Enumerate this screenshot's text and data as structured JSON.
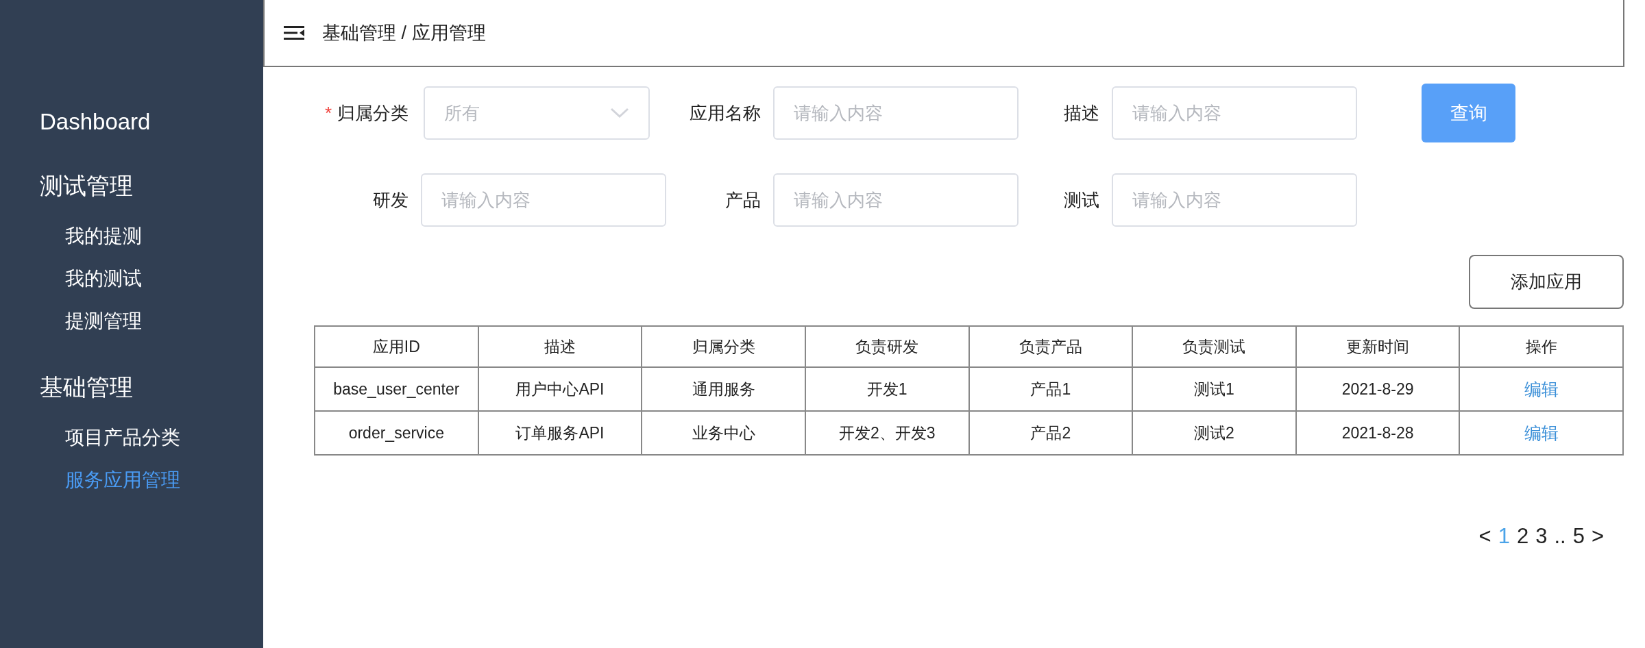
{
  "sidebar": {
    "items": [
      {
        "label": "Dashboard",
        "selected": false
      },
      {
        "label": "测试管理",
        "selected": false,
        "children": [
          {
            "label": "我的提测",
            "selected": false
          },
          {
            "label": "我的测试",
            "selected": false
          },
          {
            "label": "提测管理",
            "selected": false
          }
        ]
      },
      {
        "label": "基础管理",
        "selected": false,
        "children": [
          {
            "label": "项目产品分类",
            "selected": false
          },
          {
            "label": "服务应用管理",
            "selected": true
          }
        ]
      }
    ]
  },
  "header": {
    "breadcrumb": "基础管理 / 应用管理"
  },
  "filters": [
    {
      "label": "归属分类",
      "kind": "select",
      "required_mark": "*",
      "placeholder": "所有"
    },
    {
      "label": "应用名称",
      "kind": "input",
      "placeholder": "请输入内容"
    },
    {
      "label": "描述",
      "kind": "input",
      "placeholder": "请输入内容"
    },
    {
      "label": "研发",
      "kind": "input",
      "placeholder": "请输入内容"
    },
    {
      "label": "产品",
      "kind": "input",
      "placeholder": "请输入内容"
    },
    {
      "label": "测试",
      "kind": "input",
      "placeholder": "请输入内容"
    }
  ],
  "query_button": "查询",
  "add_button": "添加应用",
  "table": {
    "columns": [
      "应用ID",
      "描述",
      "归属分类",
      "负责研发",
      "负责产品",
      "负责测试",
      "更新时间",
      "操作"
    ],
    "rows": [
      {
        "cells": [
          "base_user_center",
          "用户中心API",
          "通用服务",
          "开发1",
          "产品1",
          "测试1",
          "2021-8-29"
        ],
        "action": "编辑"
      },
      {
        "cells": [
          "order_service",
          "订单服务API",
          "业务中心",
          "开发2、开发3",
          "产品2",
          "测试2",
          "2021-8-28"
        ],
        "action": "编辑"
      }
    ]
  },
  "pagination": {
    "prev": "<",
    "next": ">",
    "pages": [
      {
        "label": "1",
        "kind": "page",
        "selected": true
      },
      {
        "label": "2",
        "kind": "page",
        "selected": false
      },
      {
        "label": "3",
        "kind": "page",
        "selected": false
      },
      {
        "label": "..",
        "kind": "ellipsis"
      },
      {
        "label": "5",
        "kind": "page",
        "selected": false
      }
    ]
  }
}
